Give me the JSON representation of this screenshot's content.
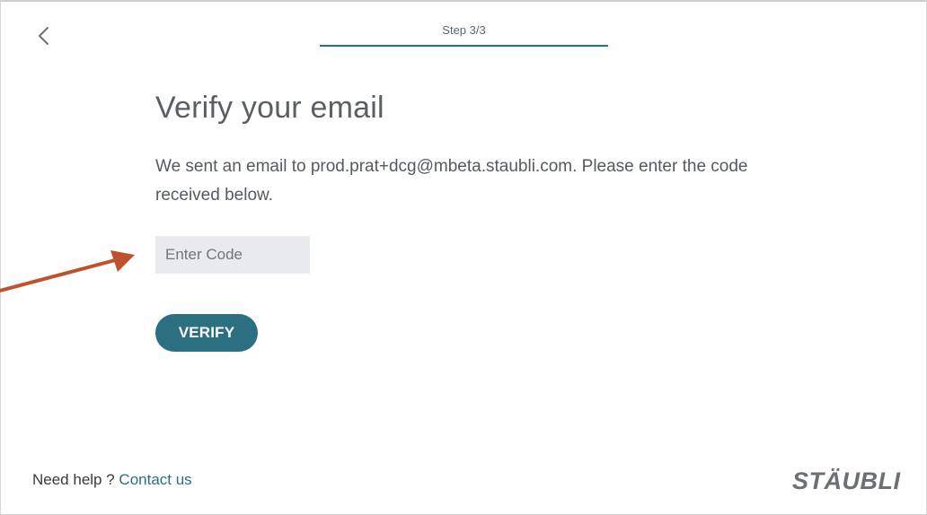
{
  "header": {
    "step_label": "Step 3/3"
  },
  "main": {
    "title": "Verify your email",
    "message": "We sent an email to prod.prat+dcg@mbeta.staubli.com. Please enter the code received below.",
    "code_input": {
      "placeholder": "Enter Code",
      "value": ""
    },
    "verify_label": "VERIFY"
  },
  "footer": {
    "help_text": "Need help ?",
    "contact_link": "Contact us",
    "logo_text": "STÄUBLI"
  },
  "icons": {
    "back": "chevron-left-icon",
    "annotation": "arrow-icon"
  },
  "colors": {
    "accent": "#2c6f80",
    "input_bg": "#e8eaed",
    "annotation_arrow": "#c0502e",
    "text": "#555a5e"
  }
}
